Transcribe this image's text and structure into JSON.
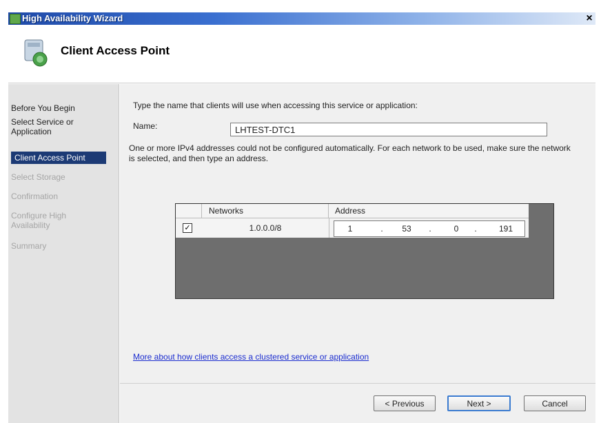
{
  "window": {
    "title": "High Availability Wizard",
    "close_label": "×"
  },
  "header": {
    "title": "Client Access Point"
  },
  "sidebar": {
    "items": [
      {
        "label": "Before You Begin",
        "state": "normal"
      },
      {
        "label": "Select Service or Application",
        "state": "normal"
      },
      {
        "label": "Client Access Point",
        "state": "selected"
      },
      {
        "label": "Select Storage",
        "state": "disabled"
      },
      {
        "label": "Confirmation",
        "state": "disabled"
      },
      {
        "label": "Configure High Availability",
        "state": "disabled"
      },
      {
        "label": "Summary",
        "state": "disabled"
      }
    ]
  },
  "main": {
    "instruction": "Type the name that clients will use when accessing this service or application:",
    "name_label": "Name:",
    "name_value": "LHTEST-DTC1",
    "note": "One or more IPv4 addresses could not be configured automatically.  For each network to be used, make sure the network is selected, and then type an address.",
    "grid": {
      "headers": {
        "networks": "Networks",
        "address": "Address"
      },
      "rows": [
        {
          "checked": true,
          "check_mark": "✓",
          "network": "1.0.0.0/8",
          "octets": [
            "1",
            "53",
            "0",
            "191"
          ]
        }
      ],
      "dot": "."
    },
    "link": "More about how clients access a clustered service or application"
  },
  "buttons": {
    "previous": "< Previous",
    "next": "Next >",
    "cancel": "Cancel"
  }
}
